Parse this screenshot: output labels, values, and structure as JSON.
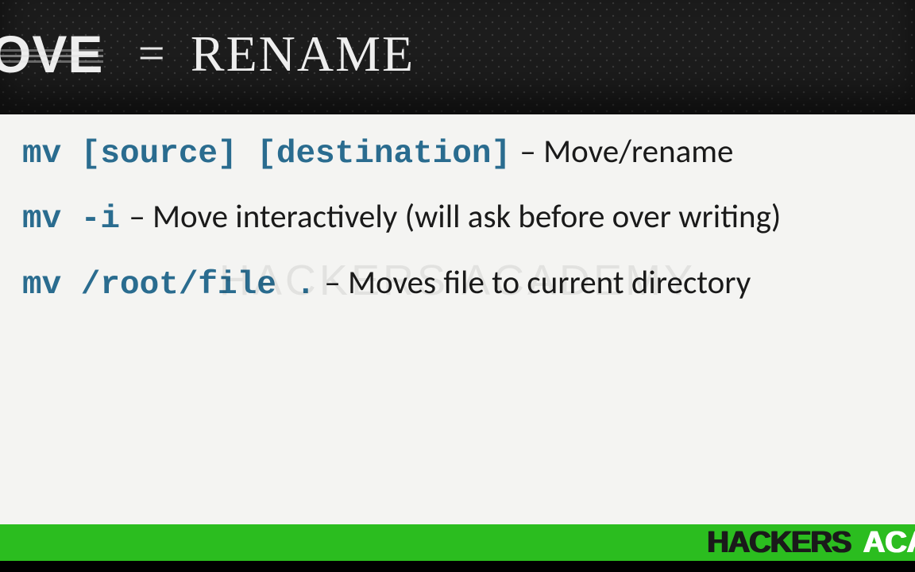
{
  "header": {
    "move": "MOVE",
    "eq": "=",
    "rename": "RENAME"
  },
  "lines": {
    "l1_cmd": "mv [source] [destination]",
    "l1_desc": "– Move/rename",
    "l2_cmd": "mv -i",
    "l2_desc": "– Move interactively (will ask before over writing)",
    "l3_cmd": "mv /root/file .",
    "l3_desc": "– Moves file to current directory"
  },
  "watermark": "HACKERS ACADEMY",
  "footer": {
    "hackers": "HACKERS",
    "acade": "ACADE"
  }
}
